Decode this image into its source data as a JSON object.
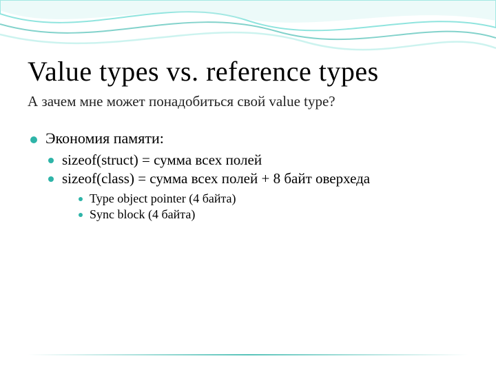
{
  "title": "Value types vs. reference types",
  "subtitle": "А зачем мне может понадобиться свой value type?",
  "bullets": {
    "l1": "Экономия памяти:",
    "l2a": "sizeof(struct) = сумма всех полей",
    "l2b": "sizeof(class) = сумма всех полей + 8 байт оверхеда",
    "l3a": "Type object pointer (4 байта)",
    "l3b": "Sync block (4 байта)"
  },
  "accent_color": "#2eb4a8"
}
